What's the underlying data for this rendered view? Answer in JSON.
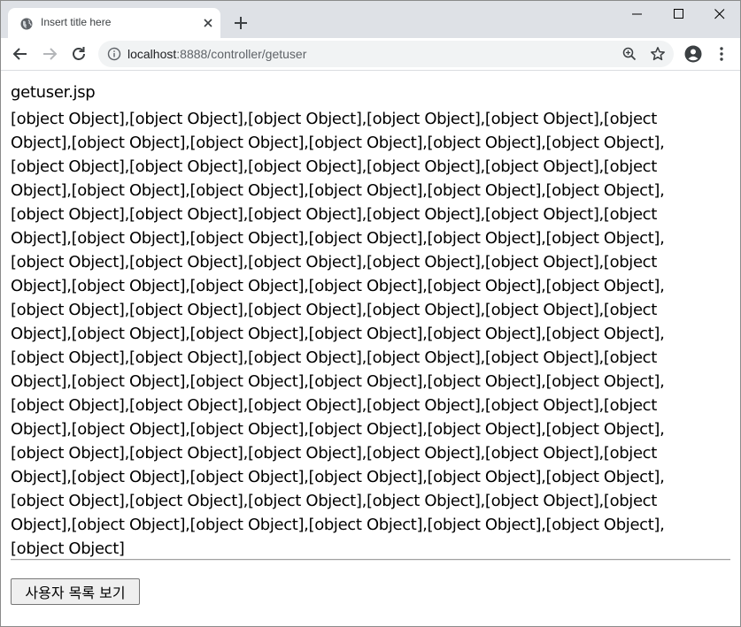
{
  "browser": {
    "tab_title": "Insert title here",
    "url_host": "localhost",
    "url_rest": ":8888/controller/getuser"
  },
  "icons": [
    "globe-icon",
    "close-icon",
    "plus-icon",
    "minimize-icon",
    "maximize-icon",
    "window-close-icon",
    "back-icon",
    "forward-icon",
    "reload-icon",
    "info-icon",
    "zoom-icon",
    "star-icon",
    "account-icon",
    "menu-icon"
  ],
  "page": {
    "heading": "getuser.jsp",
    "lines": [
      "[object Object],[object Object],[object Object],[object Object],[object Object],[object",
      "Object],[object Object],[object Object],[object Object],[object Object],[object Object],",
      "[object Object],[object Object],[object Object],[object Object],[object Object],[object",
      "Object],[object Object],[object Object],[object Object],[object Object],[object Object],",
      "[object Object],[object Object],[object Object],[object Object],[object Object],[object",
      "Object],[object Object],[object Object],[object Object],[object Object],[object Object],",
      "[object Object],[object Object],[object Object],[object Object],[object Object],[object",
      "Object],[object Object],[object Object],[object Object],[object Object],[object Object],",
      "[object Object],[object Object],[object Object],[object Object],[object Object],[object",
      "Object],[object Object],[object Object],[object Object],[object Object],[object Object],",
      "[object Object],[object Object],[object Object],[object Object],[object Object],[object",
      "Object],[object Object],[object Object],[object Object],[object Object],[object Object],",
      "[object Object],[object Object],[object Object],[object Object],[object Object],[object",
      "Object],[object Object],[object Object],[object Object],[object Object],[object Object],",
      "[object Object],[object Object],[object Object],[object Object],[object Object],[object",
      "Object],[object Object],[object Object],[object Object],[object Object],[object Object],",
      "[object Object],[object Object],[object Object],[object Object],[object Object],[object",
      "Object],[object Object],[object Object],[object Object],[object Object],[object Object],",
      "[object Object]"
    ],
    "button_label": "사용자 목록 보기"
  }
}
